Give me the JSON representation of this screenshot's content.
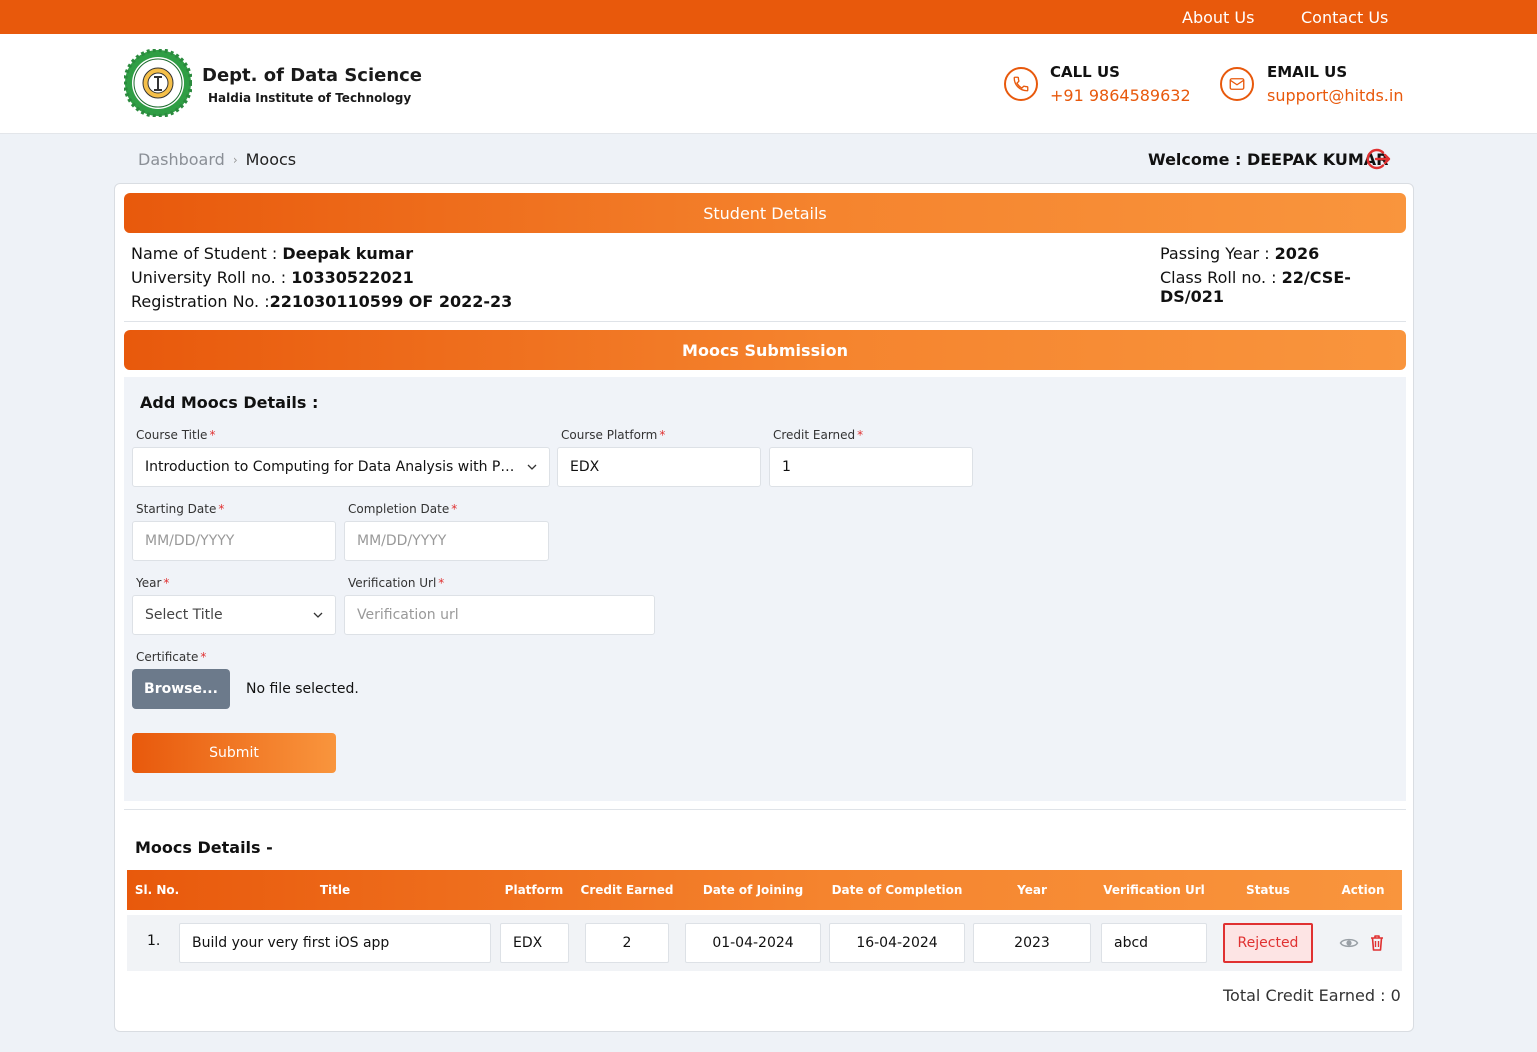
{
  "topnav": {
    "about": "About Us",
    "contact": "Contact Us"
  },
  "brand": {
    "dept": "Dept. of Data Science",
    "institute": "Haldia Institute of Technology",
    "logo_icon": "college-seal-logo"
  },
  "contact": {
    "call_label": "CALL US",
    "call_value": "+91 9864589632",
    "email_label": "EMAIL US",
    "email_value": "support@hitds.in"
  },
  "breadcrumb": {
    "dashboard": "Dashboard",
    "current": "Moocs"
  },
  "welcome": "Welcome : DEEPAK KUMAR",
  "student": {
    "band_title": "Student Details",
    "name_label": "Name of Student : ",
    "name": "Deepak kumar",
    "uroll_label": "University Roll no. : ",
    "uroll": "10330522021",
    "reg_label": "Registration No. :",
    "reg": "221030110599 OF 2022-23",
    "pass_label": "Passing Year : ",
    "pass": "2026",
    "croll_label": "Class Roll no. : ",
    "croll": "22/CSE-DS/021"
  },
  "submission": {
    "band_title": "Moocs Submission",
    "section_title": "Add Moocs Details :",
    "course_title_label": "Course Title",
    "course_title_value": "Introduction to Computing for Data Analysis with Python",
    "platform_label": "Course Platform",
    "platform_value": "EDX",
    "credit_label": "Credit Earned",
    "credit_value": "1",
    "start_label": "Starting Date",
    "start_placeholder": "MM/DD/YYYY",
    "completion_label": "Completion Date",
    "completion_placeholder": "MM/DD/YYYY",
    "year_label": "Year",
    "year_value": "Select Title",
    "url_label": "Verification Url",
    "url_placeholder": "Verification url",
    "cert_label": "Certificate",
    "browse_label": "Browse...",
    "no_file": "No file selected.",
    "submit_label": "Submit",
    "required_mark": "*"
  },
  "details": {
    "title": "Moocs Details -",
    "columns": [
      "Sl. No.",
      "Title",
      "Platform",
      "Credit Earned",
      "Date of Joining",
      "Date of Completion",
      "Year",
      "Verification Url",
      "Status",
      "Action"
    ],
    "rows": [
      {
        "sl": "1.",
        "title": "Build your very first iOS app",
        "platform": "EDX",
        "credit": "2",
        "joining": "01-04-2024",
        "completion": "16-04-2024",
        "year": "2023",
        "url": "abcd",
        "status": "Rejected"
      }
    ],
    "total": "Total Credit Earned : 0"
  },
  "colors": {
    "brand_orange": "#e8590c",
    "band_end": "#f9953d",
    "rejected_red": "#e03131",
    "browse_grey": "#6c7a8b"
  }
}
